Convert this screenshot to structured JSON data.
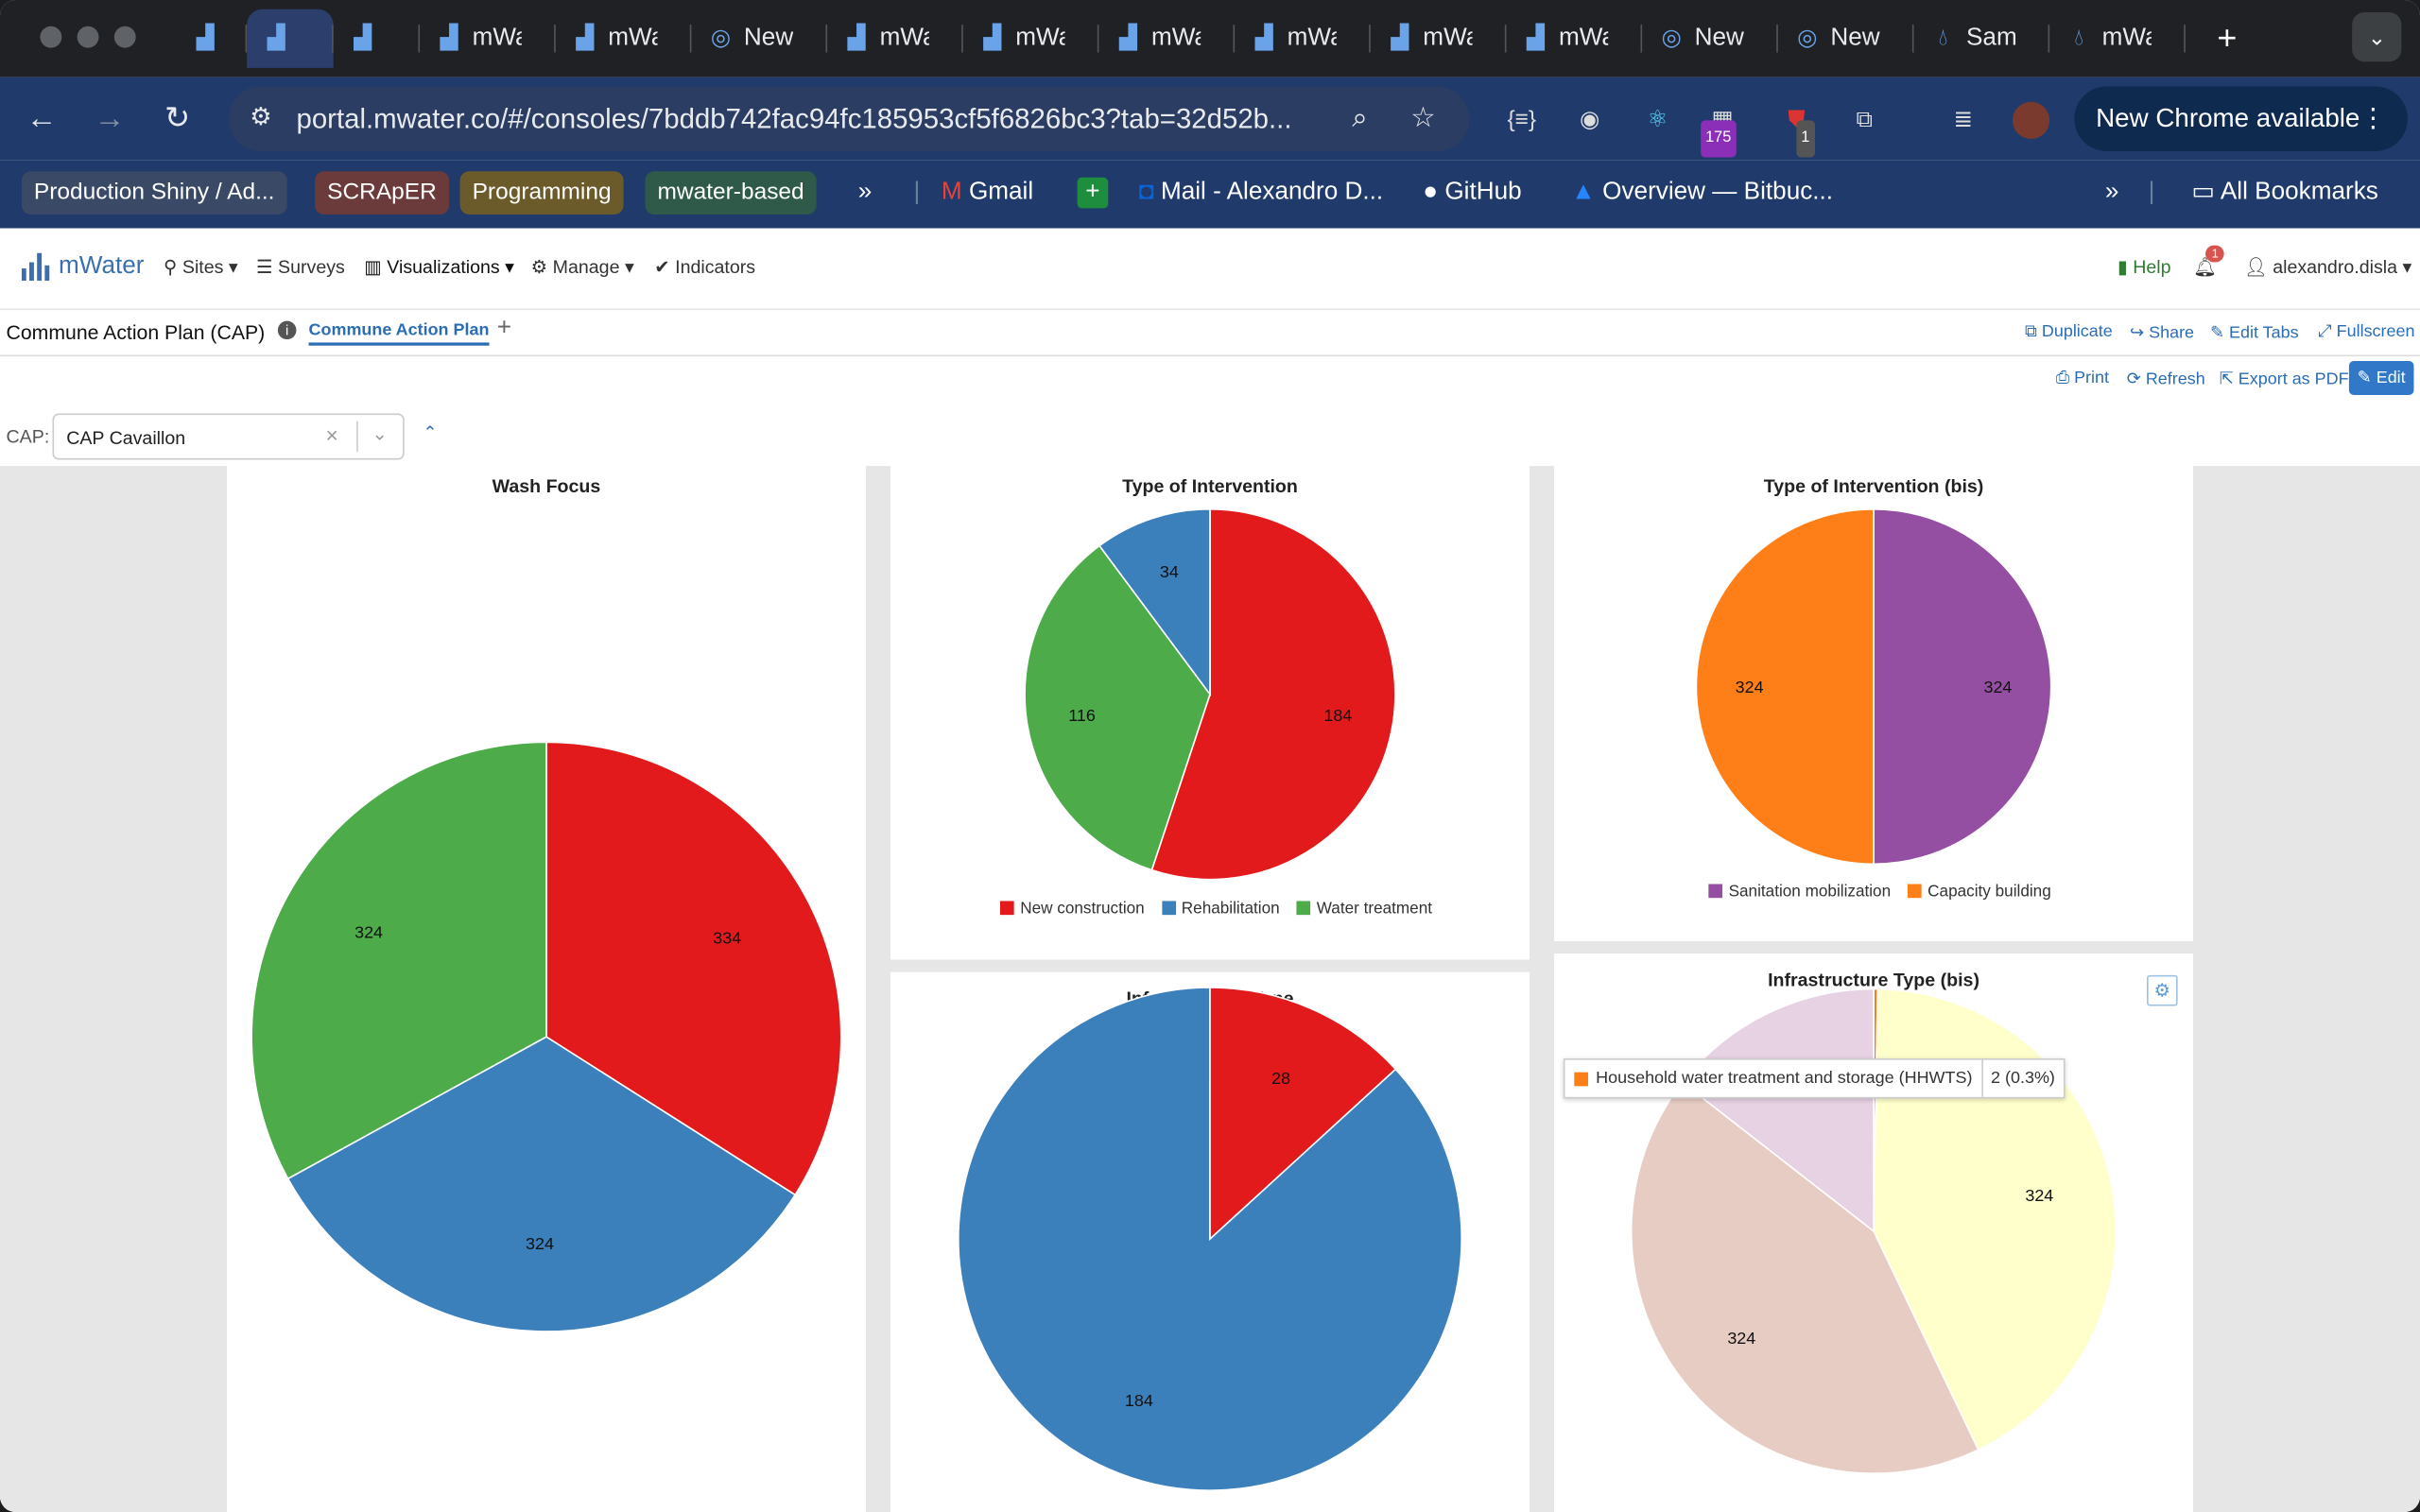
{
  "browser": {
    "tabs": [
      {
        "label": "",
        "icon": "mwater-icon"
      },
      {
        "label": "",
        "icon": "mwater-icon"
      },
      {
        "label": "",
        "icon": "mwater-icon"
      },
      {
        "label": "mWa",
        "icon": "mwater-icon"
      },
      {
        "label": "mWa",
        "icon": "mwater-icon"
      },
      {
        "label": "New",
        "icon": "chrome-icon"
      },
      {
        "label": "mWa",
        "icon": "mwater-icon"
      },
      {
        "label": "mWa",
        "icon": "mwater-icon"
      },
      {
        "label": "mWa",
        "icon": "mwater-icon"
      },
      {
        "label": "mWa",
        "icon": "mwater-icon"
      },
      {
        "label": "mWa",
        "icon": "mwater-icon"
      },
      {
        "label": "mWa",
        "icon": "mwater-icon"
      },
      {
        "label": "New",
        "icon": "chrome-icon"
      },
      {
        "label": "New",
        "icon": "chrome-icon"
      },
      {
        "label": "Sam",
        "icon": "drop-icon"
      },
      {
        "label": "mWa",
        "icon": "drop-icon"
      }
    ],
    "url": "portal.mwater.co/#/consoles/7bddb742fac94fc185953cf5f6826bc3?tab=32d52b...",
    "new_chrome": "New Chrome available",
    "ext_badge_175": "175",
    "ext_badge_1": "1",
    "bookmarks": {
      "b1": "Production Shiny / Ad...",
      "b2": "SCRApER",
      "b3": "Programming",
      "b4": "mwater-based",
      "gmail": "Gmail",
      "mail": "Mail - Alexandro D...",
      "github": "GitHub",
      "overview": "Overview — Bitbuc...",
      "all": "All Bookmarks"
    }
  },
  "app": {
    "brand": "mWater",
    "nav": {
      "sites": "Sites",
      "surveys": "Surveys",
      "visualizations": "Visualizations",
      "manage": "Manage",
      "indicators": "Indicators",
      "help": "Help",
      "notif_count": "1",
      "user": "alexandro.disla"
    },
    "console_title": "Commune Action Plan (CAP)",
    "active_tab": "Commune Action Plan",
    "tab_actions": {
      "duplicate": "Duplicate",
      "share": "Share",
      "edit_tabs": "Edit Tabs",
      "fullscreen": "Fullscreen"
    },
    "actions": {
      "print": "Print",
      "refresh": "Refresh",
      "export_pdf": "Export as PDF",
      "edit": "Edit"
    },
    "filter": {
      "label": "CAP:",
      "value": "CAP Cavaillon"
    },
    "tooltip": {
      "label": "Household water treatment and storage (HHWTS)",
      "value": "2 (0.3%)"
    },
    "colors": {
      "red": "#e31a1c",
      "blue": "#3b7fbb",
      "green": "#4dab4a",
      "purple": "#944ea2",
      "orange": "#fe7f18",
      "yellow": "#ffffcc",
      "peach": "#e6ccc2",
      "lilac": "#e7d2e4"
    }
  },
  "chart_data": [
    {
      "type": "pie",
      "title": "Wash Focus",
      "slices": [
        {
          "value": 334,
          "color": "#e31a1c"
        },
        {
          "value": 324,
          "color": "#3b7fbb"
        },
        {
          "value": 324,
          "color": "#4dab4a"
        }
      ]
    },
    {
      "type": "pie",
      "title": "Type of Intervention",
      "slices": [
        {
          "name": "New construction",
          "value": 184,
          "color": "#e31a1c"
        },
        {
          "name": "Water treatment",
          "value": 116,
          "color": "#4dab4a"
        },
        {
          "name": "Rehabilitation",
          "value": 34,
          "color": "#3b7fbb"
        }
      ],
      "legend": [
        "New construction",
        "Rehabilitation",
        "Water treatment"
      ]
    },
    {
      "type": "pie",
      "title": "Type of Intervention (bis)",
      "slices": [
        {
          "name": "Sanitation mobilization",
          "value": 324,
          "color": "#944ea2"
        },
        {
          "name": "Capacity building",
          "value": 324,
          "color": "#fe7f18"
        }
      ],
      "legend": [
        "Sanitation mobilization",
        "Capacity building"
      ]
    },
    {
      "type": "pie",
      "title": "Infrastructure Type",
      "slices": [
        {
          "value": 184,
          "color": "#3b7fbb"
        },
        {
          "value": 28,
          "color": "#e31a1c"
        }
      ]
    },
    {
      "type": "pie",
      "title": "Infrastructure Type (bis)",
      "slices": [
        {
          "name": "Household water treatment and storage (HHWTS)",
          "value": 2,
          "color": "#fe7f18"
        },
        {
          "value": 324,
          "color": "#ffffcc"
        },
        {
          "value": 324,
          "color": "#e6ccc2"
        },
        {
          "value": 110,
          "color": "#e7d2e4"
        }
      ]
    }
  ]
}
